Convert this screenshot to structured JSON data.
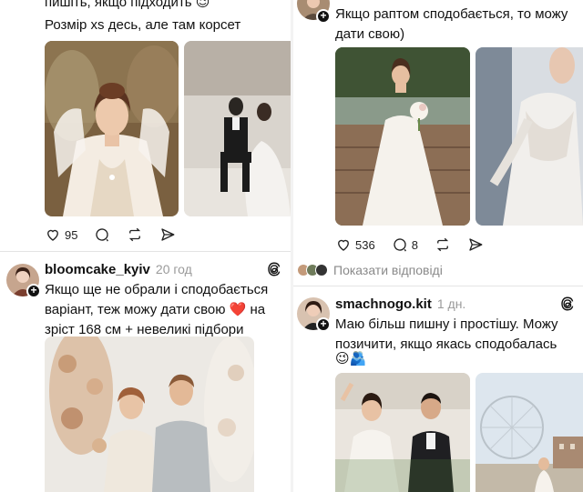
{
  "left_column": {
    "post1": {
      "text_line1": "пишіть, якщо підходить 😉",
      "text_line2": "Розмір xs десь, але там корсет",
      "likes": "95"
    },
    "post2": {
      "username": "bloomcake_kyiv",
      "time": "20 год",
      "text_line1": "Якщо ще не обрали і сподобається",
      "text_line2": "варіант, теж можу дати свою ❤️ на",
      "text_line3": "зріст 168 см + невеликі підбори"
    }
  },
  "right_column": {
    "post1": {
      "text_line1": "Якщо раптом сподобається, то можу",
      "text_line2": "дати свою)",
      "likes": "536",
      "comments": "8"
    },
    "replies_label": "Показати відповіді",
    "post2": {
      "username": "smachnogo.kit",
      "time": "1 дн.",
      "text_line1": "Маю більш пишну і простішу. Можу",
      "text_line2": "позичити, якщо якась сподобалась",
      "text_line3": "😉🫂"
    }
  },
  "icons": {
    "like": "heart-icon",
    "comment": "comment-icon",
    "repost": "repost-icon",
    "share": "share-icon",
    "threads": "threads-logo-icon",
    "follow": "plus-icon"
  }
}
